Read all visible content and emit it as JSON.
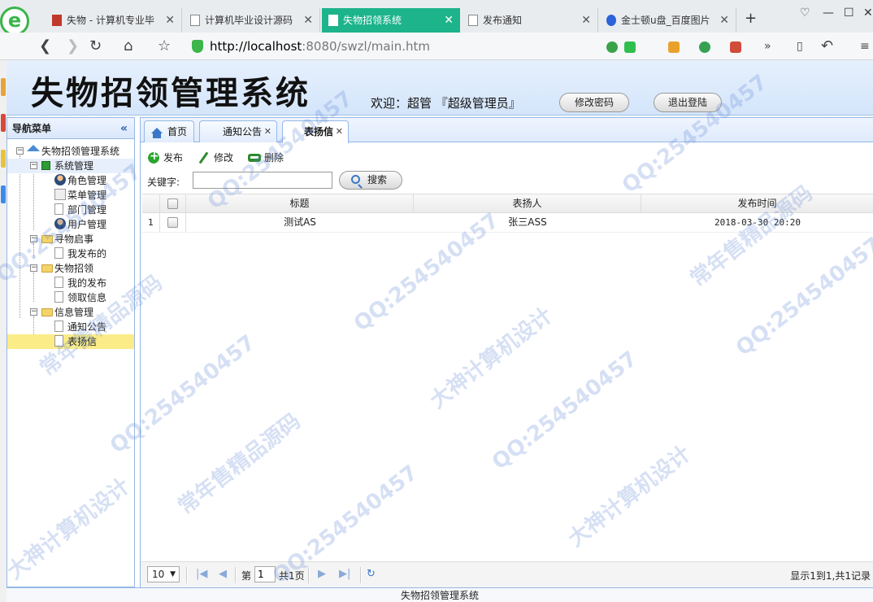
{
  "browser": {
    "tabs": [
      {
        "label": "失物 - 计算机专业毕"
      },
      {
        "label": "计算机毕业设计源码"
      },
      {
        "label": "失物招领系统"
      },
      {
        "label": "发布通知"
      },
      {
        "label": "金士顿u盘_百度图片"
      }
    ],
    "url_host": "http://localhost",
    "url_rest": ":8080/swzl/main.htm",
    "accent_color": "#1db38b"
  },
  "header": {
    "title": "失物招领管理系统",
    "welcome": "欢迎：超管 『超级管理员』",
    "change_password": "修改密码",
    "logout": "退出登陆"
  },
  "nav": {
    "title": "导航菜单",
    "root": "失物招领管理系统",
    "groups": [
      {
        "label": "系统管理",
        "items": [
          "角色管理",
          "菜单管理",
          "部门管理",
          "用户管理"
        ]
      },
      {
        "label": "寻物启事",
        "items": [
          "我发布的"
        ]
      },
      {
        "label": "失物招领",
        "items": [
          "我的发布",
          "领取信息"
        ]
      },
      {
        "label": "信息管理",
        "items": [
          "通知公告",
          "表扬信"
        ]
      }
    ]
  },
  "tabs": [
    {
      "label": "首页"
    },
    {
      "label": "通知公告"
    },
    {
      "label": "表扬信"
    }
  ],
  "toolbar": {
    "add": "发布",
    "edit": "修改",
    "delete": "删除"
  },
  "search": {
    "label": "关键字:",
    "value": "",
    "button": "搜索"
  },
  "grid": {
    "columns": [
      "标题",
      "表扬人",
      "发布时间"
    ],
    "rows": [
      {
        "num": "1",
        "title": "测试AS",
        "person": "张三ASS",
        "time": "2018-03-30 20:20"
      }
    ]
  },
  "pager": {
    "page_size": "10",
    "page_prefix": "第",
    "page_value": "1",
    "page_total": "共1页",
    "info": "显示1到1,共1记录"
  },
  "footer": "失物招领管理系统",
  "watermark": [
    "QQ:254540457",
    "常年售精品源码",
    "大神计算机设计"
  ]
}
